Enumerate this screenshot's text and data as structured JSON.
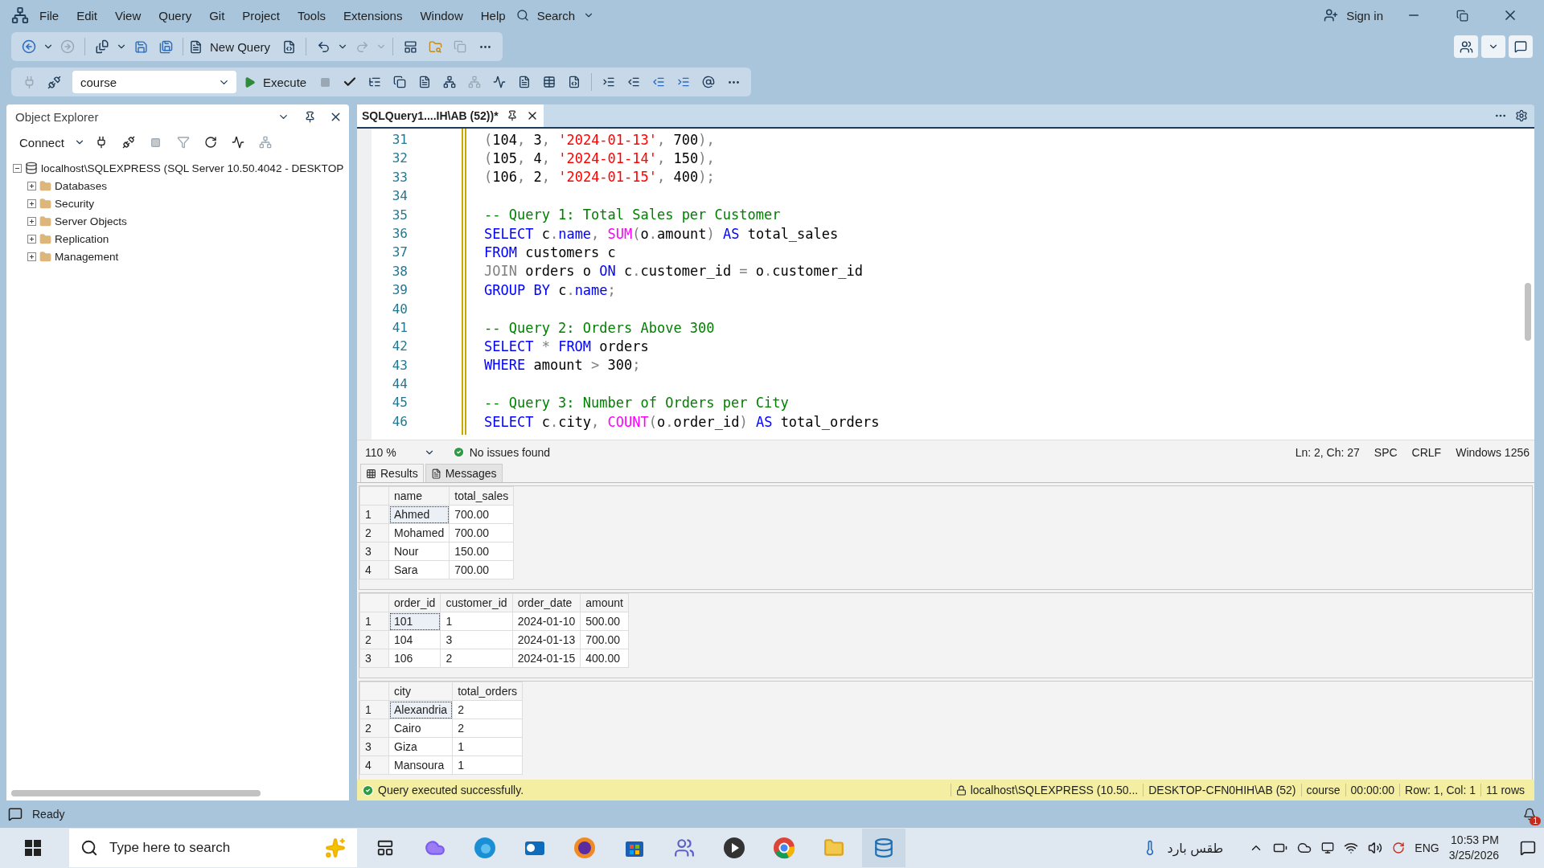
{
  "menu": [
    "File",
    "Edit",
    "View",
    "Query",
    "Git",
    "Project",
    "Tools",
    "Extensions",
    "Window",
    "Help"
  ],
  "search": {
    "label": "Search"
  },
  "account": {
    "label": "Sign in"
  },
  "toolbar": {
    "new_query": "New Query",
    "database": "course",
    "execute": "Execute"
  },
  "object_explorer": {
    "title": "Object Explorer",
    "connect": "Connect",
    "tree": [
      {
        "label": "localhost\\SQLEXPRESS (SQL Server 10.50.4042 - DESKTOP",
        "kind": "server",
        "expanded": true,
        "children": [
          {
            "label": "Databases",
            "kind": "folder",
            "expanded": false
          },
          {
            "label": "Security",
            "kind": "folder",
            "expanded": false
          },
          {
            "label": "Server Objects",
            "kind": "folder",
            "expanded": false
          },
          {
            "label": "Replication",
            "kind": "folder",
            "expanded": false
          },
          {
            "label": "Management",
            "kind": "folder",
            "expanded": false
          }
        ]
      }
    ]
  },
  "editor": {
    "tab": {
      "title": "SQLQuery1....IH\\AB (52))*",
      "selected": true
    },
    "lines": [
      {
        "num": "31",
        "tokens": [
          {
            "kind": "op",
            "text": "("
          },
          {
            "kind": "plain",
            "text": "104"
          },
          {
            "kind": "op",
            "text": ", "
          },
          {
            "kind": "plain",
            "text": "3"
          },
          {
            "kind": "op",
            "text": ", "
          },
          {
            "kind": "str",
            "text": "'2024-01-13'"
          },
          {
            "kind": "op",
            "text": ", "
          },
          {
            "kind": "plain",
            "text": "700"
          },
          {
            "kind": "op",
            "text": "),"
          }
        ]
      },
      {
        "num": "32",
        "tokens": [
          {
            "kind": "op",
            "text": "("
          },
          {
            "kind": "plain",
            "text": "105"
          },
          {
            "kind": "op",
            "text": ", "
          },
          {
            "kind": "plain",
            "text": "4"
          },
          {
            "kind": "op",
            "text": ", "
          },
          {
            "kind": "str",
            "text": "'2024-01-14'"
          },
          {
            "kind": "op",
            "text": ", "
          },
          {
            "kind": "plain",
            "text": "150"
          },
          {
            "kind": "op",
            "text": "),"
          }
        ]
      },
      {
        "num": "33",
        "tokens": [
          {
            "kind": "op",
            "text": "("
          },
          {
            "kind": "plain",
            "text": "106"
          },
          {
            "kind": "op",
            "text": ", "
          },
          {
            "kind": "plain",
            "text": "2"
          },
          {
            "kind": "op",
            "text": ", "
          },
          {
            "kind": "str",
            "text": "'2024-01-15'"
          },
          {
            "kind": "op",
            "text": ", "
          },
          {
            "kind": "plain",
            "text": "400"
          },
          {
            "kind": "op",
            "text": ");"
          }
        ]
      },
      {
        "num": "34"
      },
      {
        "num": "35",
        "tokens": [
          {
            "kind": "cmt",
            "text": "-- Query 1: Total Sales per Customer"
          }
        ]
      },
      {
        "num": "36",
        "tokens": [
          {
            "kind": "kw",
            "text": "SELECT "
          },
          {
            "kind": "plain",
            "text": "c"
          },
          {
            "kind": "op",
            "text": "."
          },
          {
            "kind": "kw",
            "text": "name"
          },
          {
            "kind": "op",
            "text": ", "
          },
          {
            "kind": "fn",
            "text": "SUM"
          },
          {
            "kind": "op",
            "text": "("
          },
          {
            "kind": "plain",
            "text": "o"
          },
          {
            "kind": "op",
            "text": "."
          },
          {
            "kind": "plain",
            "text": "amount"
          },
          {
            "kind": "op",
            "text": ") "
          },
          {
            "kind": "kw",
            "text": "AS "
          },
          {
            "kind": "plain",
            "text": "total_sales"
          }
        ]
      },
      {
        "num": "37",
        "tokens": [
          {
            "kind": "kw",
            "text": "FROM "
          },
          {
            "kind": "plain",
            "text": "customers c"
          }
        ]
      },
      {
        "num": "38",
        "tokens": [
          {
            "kind": "op",
            "text": "JOIN "
          },
          {
            "kind": "plain",
            "text": "orders o "
          },
          {
            "kind": "kw",
            "text": "ON "
          },
          {
            "kind": "plain",
            "text": "c"
          },
          {
            "kind": "op",
            "text": "."
          },
          {
            "kind": "plain",
            "text": "customer_id "
          },
          {
            "kind": "op",
            "text": "= "
          },
          {
            "kind": "plain",
            "text": "o"
          },
          {
            "kind": "op",
            "text": "."
          },
          {
            "kind": "plain",
            "text": "customer_id"
          }
        ]
      },
      {
        "num": "39",
        "tokens": [
          {
            "kind": "kw",
            "text": "GROUP BY "
          },
          {
            "kind": "plain",
            "text": "c"
          },
          {
            "kind": "op",
            "text": "."
          },
          {
            "kind": "kw",
            "text": "name"
          },
          {
            "kind": "op",
            "text": ";"
          }
        ]
      },
      {
        "num": "40"
      },
      {
        "num": "41",
        "tokens": [
          {
            "kind": "cmt",
            "text": "-- Query 2: Orders Above 300"
          }
        ]
      },
      {
        "num": "42",
        "tokens": [
          {
            "kind": "kw",
            "text": "SELECT "
          },
          {
            "kind": "op",
            "text": "* "
          },
          {
            "kind": "kw",
            "text": "FROM "
          },
          {
            "kind": "plain",
            "text": "orders"
          }
        ]
      },
      {
        "num": "43",
        "tokens": [
          {
            "kind": "kw",
            "text": "WHERE "
          },
          {
            "kind": "plain",
            "text": "amount "
          },
          {
            "kind": "op",
            "text": "> "
          },
          {
            "kind": "plain",
            "text": "300"
          },
          {
            "kind": "op",
            "text": ";"
          }
        ]
      },
      {
        "num": "44"
      },
      {
        "num": "45",
        "tokens": [
          {
            "kind": "cmt",
            "text": "-- Query 3: Number of Orders per City"
          }
        ]
      },
      {
        "num": "46",
        "tokens": [
          {
            "kind": "kw",
            "text": "SELECT "
          },
          {
            "kind": "plain",
            "text": "c"
          },
          {
            "kind": "op",
            "text": "."
          },
          {
            "kind": "plain",
            "text": "city"
          },
          {
            "kind": "op",
            "text": ", "
          },
          {
            "kind": "fn",
            "text": "COUNT"
          },
          {
            "kind": "op",
            "text": "("
          },
          {
            "kind": "plain",
            "text": "o"
          },
          {
            "kind": "op",
            "text": "."
          },
          {
            "kind": "plain",
            "text": "order_id"
          },
          {
            "kind": "op",
            "text": ") "
          },
          {
            "kind": "kw",
            "text": "AS "
          },
          {
            "kind": "plain",
            "text": "total_orders"
          }
        ]
      }
    ],
    "status": {
      "zoom": "110 %",
      "issues": "No issues found",
      "position": "Ln: 2, Ch: 27",
      "spacing": "SPC",
      "line_ending": "CRLF",
      "encoding": "Windows 1256"
    }
  },
  "results": {
    "tabs": [
      {
        "label": "Results",
        "selected": true
      },
      {
        "label": "Messages",
        "selected": false
      }
    ],
    "grids": [
      {
        "columns": [
          "name",
          "total_sales"
        ],
        "rows": [
          {
            "num": "1",
            "selected": true,
            "cells": [
              "Ahmed",
              "700.00"
            ]
          },
          {
            "num": "2",
            "selected": false,
            "cells": [
              "Mohamed",
              "700.00"
            ]
          },
          {
            "num": "3",
            "selected": false,
            "cells": [
              "Nour",
              "150.00"
            ]
          },
          {
            "num": "4",
            "selected": false,
            "cells": [
              "Sara",
              "700.00"
            ]
          }
        ]
      },
      {
        "columns": [
          "order_id",
          "customer_id",
          "order_date",
          "amount"
        ],
        "rows": [
          {
            "num": "1",
            "selected": true,
            "cells": [
              "101",
              "1",
              "2024-01-10",
              "500.00"
            ]
          },
          {
            "num": "2",
            "selected": false,
            "cells": [
              "104",
              "3",
              "2024-01-13",
              "700.00"
            ]
          },
          {
            "num": "3",
            "selected": false,
            "cells": [
              "106",
              "2",
              "2024-01-15",
              "400.00"
            ]
          }
        ]
      },
      {
        "columns": [
          "city",
          "total_orders"
        ],
        "rows": [
          {
            "num": "1",
            "selected": true,
            "cells": [
              "Alexandria",
              "2"
            ]
          },
          {
            "num": "2",
            "selected": false,
            "cells": [
              "Cairo",
              "2"
            ]
          },
          {
            "num": "3",
            "selected": false,
            "cells": [
              "Giza",
              "1"
            ]
          },
          {
            "num": "4",
            "selected": false,
            "cells": [
              "Mansoura",
              "1"
            ]
          }
        ]
      }
    ]
  },
  "query_status": {
    "message": "Query executed successfully.",
    "server": "localhost\\SQLEXPRESS (10.50...",
    "user": "DESKTOP-CFN0HIH\\AB (52)",
    "database": "course",
    "elapsed": "00:00:00",
    "position": "Row: 1, Col: 1",
    "rows": "11 rows"
  },
  "status_bar": {
    "text": "Ready"
  },
  "taskbar": {
    "search_placeholder": "Type here to search",
    "weather": "طقس بارد",
    "language": "ENG",
    "time": "10:53 PM",
    "date": "3/25/2026",
    "notification_count": "1"
  }
}
